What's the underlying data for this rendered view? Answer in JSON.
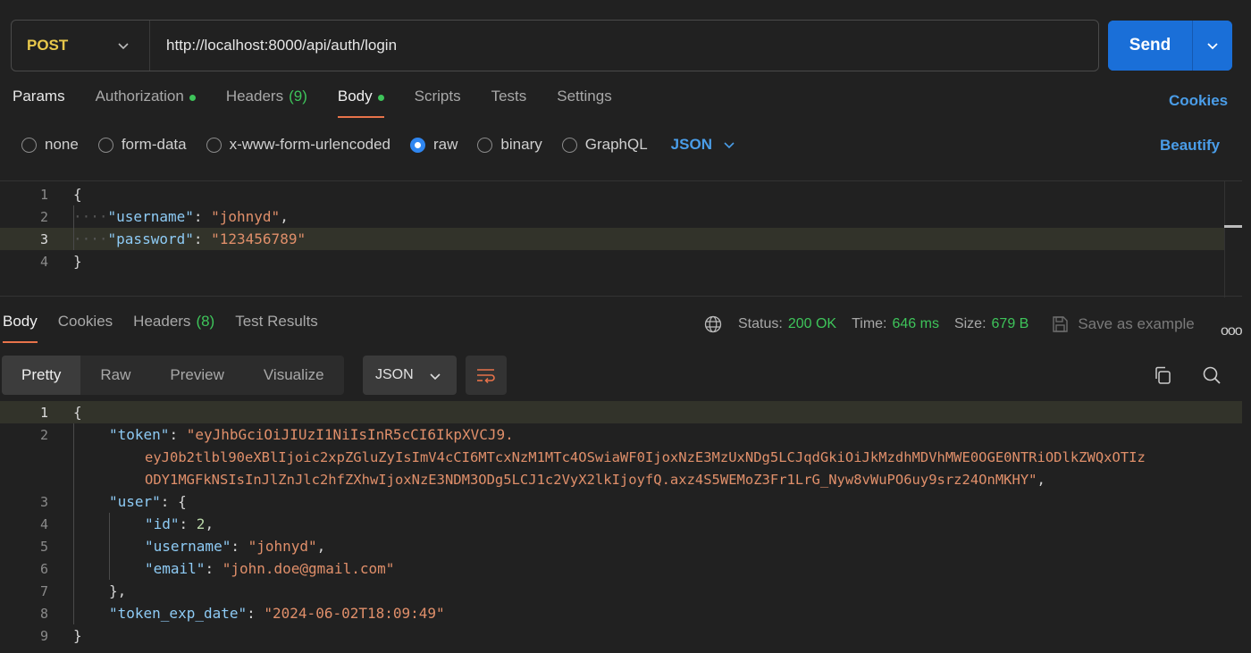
{
  "request": {
    "method": "POST",
    "url": "http://localhost:8000/api/auth/login",
    "send_label": "Send"
  },
  "request_tabs": {
    "params": "Params",
    "authorization": "Authorization",
    "headers": "Headers",
    "headers_count": "(9)",
    "body": "Body",
    "scripts": "Scripts",
    "tests": "Tests",
    "settings": "Settings",
    "cookies": "Cookies"
  },
  "body_types": {
    "none": "none",
    "form_data": "form-data",
    "urlencoded": "x-www-form-urlencoded",
    "raw": "raw",
    "binary": "binary",
    "graphql": "GraphQL",
    "format": "JSON",
    "beautify": "Beautify",
    "selected": "raw"
  },
  "request_body": {
    "line_numbers": [
      "1",
      "2",
      "3",
      "4"
    ],
    "open_brace": "{",
    "close_brace": "}",
    "username_key": "\"username\"",
    "username_value": "\"johnyd\"",
    "password_key": "\"password\"",
    "password_value": "\"123456789\""
  },
  "response_tabs": {
    "body": "Body",
    "cookies": "Cookies",
    "headers": "Headers",
    "headers_count": "(8)",
    "test_results": "Test Results"
  },
  "response_status": {
    "status_label": "Status:",
    "status_value": "200 OK",
    "time_label": "Time:",
    "time_value": "646 ms",
    "size_label": "Size:",
    "size_value": "679 B",
    "save_example": "Save as example",
    "more": "ooo"
  },
  "response_view": {
    "pretty": "Pretty",
    "raw": "Raw",
    "preview": "Preview",
    "visualize": "Visualize",
    "format": "JSON"
  },
  "response_body": {
    "line_numbers": [
      "1",
      "2",
      "3",
      "4",
      "5",
      "6",
      "7",
      "8",
      "9"
    ],
    "open_brace": "{",
    "close_brace": "}",
    "token_key": "\"token\"",
    "token_line1": "\"eyJhbGciOiJIUzI1NiIsInR5cCI6IkpXVCJ9.",
    "token_line2": "eyJ0b2tlbl90eXBlIjoic2xpZGluZyIsImV4cCI6MTcxNzM1MTc4OSwiaWF0IjoxNzE3MzUxNDg5LCJqdGkiOiJkMzdhMDVhMWE0OGE0NTRiODlkZWQxOTIz",
    "token_line3": "ODY1MGFkNSIsInJlZnJlc2hfZXhwIjoxNzE3NDM3ODg5LCJ1c2VyX2lkIjoyfQ.axz4S5WEMoZ3Fr1LrG_Nyw8vWuPO6uy9srz24OnMKHY\"",
    "user_key": "\"user\"",
    "id_key": "\"id\"",
    "id_value": "2",
    "username_key": "\"username\"",
    "username_value": "\"johnyd\"",
    "email_key": "\"email\"",
    "email_value": "\"john.doe@gmail.com\"",
    "user_close": "},",
    "exp_key": "\"token_exp_date\"",
    "exp_value": "\"2024-06-02T18:09:49\""
  },
  "colors": {
    "accent": "#1a6fd8",
    "method": "#e8c84b",
    "success": "#3ec45a",
    "link": "#4a9de8",
    "tab_underline": "#e8734a"
  },
  "icons": [
    "chevron-down-icon",
    "globe-icon",
    "save-icon",
    "wrap-lines-icon",
    "copy-icon",
    "search-icon"
  ]
}
